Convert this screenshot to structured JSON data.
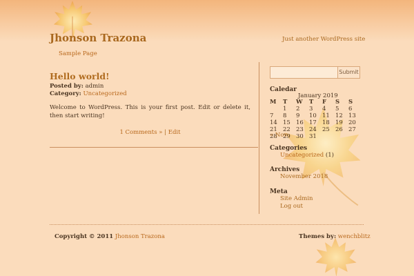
{
  "site": {
    "title": "Jhonson Trazona",
    "tagline": "Just another WordPress site"
  },
  "nav": {
    "items": [
      {
        "label": "Sample Page"
      }
    ]
  },
  "post": {
    "title": "Hello world!",
    "posted_by_label": "Posted by:",
    "posted_by": "admin",
    "category_label": "Category:",
    "category": "Uncategorized",
    "body": "Welcome to WordPress. This is your first post. Edit or delete it, then start writing!",
    "comments_link": "1 Comments »",
    "separator": " | ",
    "edit_link": "Edit"
  },
  "search": {
    "button_label": "Submit",
    "value": ""
  },
  "calendar": {
    "widget_title": "Caledar",
    "caption": "January 2019",
    "weekdays": [
      "M",
      "T",
      "W",
      "T",
      "F",
      "S",
      "S"
    ],
    "weeks": [
      [
        "",
        "1",
        "2",
        "3",
        "4",
        "5",
        "6"
      ],
      [
        "7",
        "8",
        "9",
        "10",
        "11",
        "12",
        "13"
      ],
      [
        "14",
        "15",
        "16",
        "17",
        "18",
        "19",
        "20"
      ],
      [
        "21",
        "22",
        "23",
        "24",
        "25",
        "26",
        "27"
      ],
      [
        "28",
        "29",
        "30",
        "31",
        "",
        "",
        ""
      ]
    ],
    "prev_link": "« Nov"
  },
  "categories": {
    "title": "Categories",
    "items": [
      {
        "label": "Uncategorized",
        "count": "(1)"
      }
    ]
  },
  "archives": {
    "title": "Archives",
    "items": [
      {
        "label": "November 2018"
      }
    ]
  },
  "meta": {
    "title": "Meta",
    "items": [
      {
        "label": "Site Admin"
      },
      {
        "label": "Log out"
      }
    ]
  },
  "footer": {
    "copyright_label": "Copyright © 2011",
    "copyright_name": "Jhonson Trazona",
    "themes_label": "Themes by:",
    "themes_author": "wenchblitz"
  },
  "colors": {
    "background": "#fbdcbc",
    "header_gradient_top": "#f3b57c",
    "link": "#a9681e",
    "text": "#4a3420",
    "rule": "#c98e5e"
  }
}
